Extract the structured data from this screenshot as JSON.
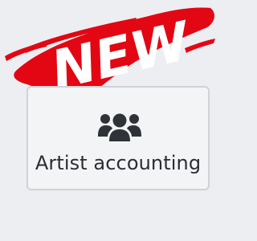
{
  "badge": {
    "text": "NEW",
    "color": "#e30613",
    "text_color": "#ffffff"
  },
  "card": {
    "icon": "users-icon",
    "label": "Artist accounting",
    "background": "#f3f4f6",
    "border": "#cfd2d6",
    "text_color": "#2a2d31"
  }
}
